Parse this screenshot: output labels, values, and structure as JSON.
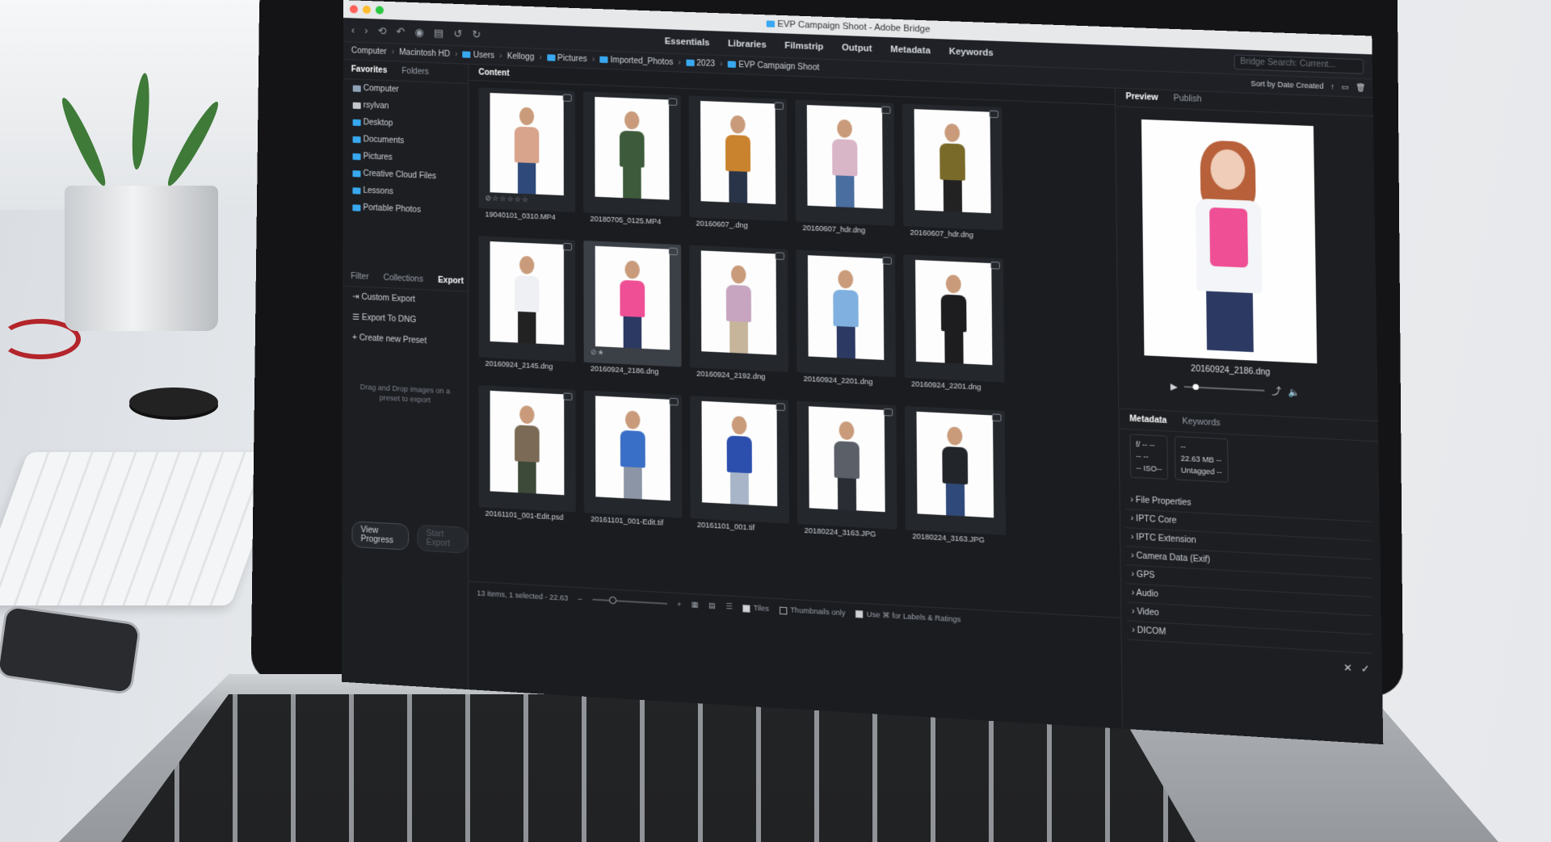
{
  "window": {
    "title": "EVP Campaign Shoot - Adobe Bridge"
  },
  "toolbar": {
    "workspaces": [
      "Essentials",
      "Libraries",
      "Filmstrip",
      "Output",
      "Metadata",
      "Keywords"
    ],
    "search_placeholder": "Bridge Search: Current..."
  },
  "path": [
    "Computer",
    "Macintosh HD",
    "Users",
    "Kellogg",
    "Pictures",
    "Imported_Photos",
    "2023",
    "EVP Campaign Shoot"
  ],
  "left_panel": {
    "tabs": [
      "Favorites",
      "Folders"
    ],
    "favorites": [
      "Computer",
      "rsylvan",
      "Desktop",
      "Documents",
      "Pictures",
      "Creative Cloud Files",
      "Lessons",
      "Portable Photos"
    ],
    "export_tabs": [
      "Filter",
      "Collections",
      "Export"
    ],
    "export_items": [
      "Custom Export",
      "Export To DNG",
      "Create new Preset"
    ],
    "hint": "Drag and Drop images on a preset to export",
    "view_progress": "View Progress",
    "start_export": "Start Export"
  },
  "content": {
    "tab": "Content",
    "items": [
      {
        "name": "19040101_0310.MP4",
        "torso": "#d9a48c",
        "legs": "#2f4a7a"
      },
      {
        "name": "20180705_0125.MP4",
        "torso": "#3d5b3a",
        "legs": "#3d5b3a"
      },
      {
        "name": "20160607_.dng",
        "torso": "#c9822e",
        "legs": "#2a3448"
      },
      {
        "name": "20160607_hdr.dng",
        "torso": "#d9b5c8",
        "legs": "#4a6ea0"
      },
      {
        "name": "20160607_hdr.dng",
        "torso": "#7a6a2a",
        "legs": "#222"
      },
      {
        "name": "20160924_2145.dng",
        "torso": "#eef0f3",
        "legs": "#222"
      },
      {
        "name": "20160924_2186.dng",
        "torso": "#ef4f95",
        "legs": "#2c3a63"
      },
      {
        "name": "20160924_2192.dng",
        "torso": "#c7a5c0",
        "legs": "#c6b59a"
      },
      {
        "name": "20160924_2201.dng",
        "torso": "#7fb0e0",
        "legs": "#2c3a63"
      },
      {
        "name": "20160924_2201.dng",
        "torso": "#1d1d1f",
        "legs": "#1d1d1f"
      },
      {
        "name": "20161101_001-Edit.psd",
        "torso": "#7b6a55",
        "legs": "#3d4a3a"
      },
      {
        "name": "20161101_001-Edit.tif",
        "torso": "#3a6fc7",
        "legs": "#8c95a5"
      },
      {
        "name": "20161101_001.tif",
        "torso": "#2c4fae",
        "legs": "#a8b4c8"
      },
      {
        "name": "20180224_3163.JPG",
        "torso": "#5b6068",
        "legs": "#2a2d33"
      },
      {
        "name": "20180224_3163.JPG",
        "torso": "#22252a",
        "legs": "#2f4a7a"
      }
    ],
    "status": "13 items, 1 selected - 22.63",
    "tiles_label": "Tiles",
    "thumbs_label": "Thumbnails only",
    "labels_label": "Use ⌘ for Labels & Ratings"
  },
  "right_panel": {
    "sort_label": "Sort by Date Created",
    "tabs": [
      "Preview",
      "Publish"
    ],
    "preview_name": "20160924_2186.dng",
    "meta_tabs": [
      "Metadata",
      "Keywords"
    ],
    "meta_box1": [
      "f/ --  --",
      "--  --",
      "--  ISO--"
    ],
    "meta_box2": [
      "--",
      "22.63 MB  --",
      "Untagged  --"
    ],
    "sections": [
      "File Properties",
      "IPTC Core",
      "IPTC Extension",
      "Camera Data (Exif)",
      "GPS",
      "Audio",
      "Video",
      "DICOM"
    ]
  }
}
